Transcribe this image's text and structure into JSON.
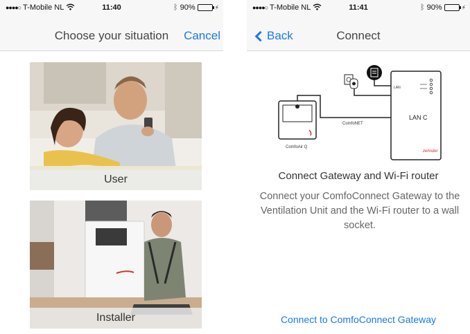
{
  "status_left": {
    "carrier": "T-Mobile NL",
    "time": "11:40",
    "battery": "90%",
    "battery_level": 0.9
  },
  "status_right": {
    "carrier": "T-Mobile NL",
    "time": "11:41",
    "battery": "90%",
    "battery_level": 0.9
  },
  "situation": {
    "title": "Choose your situation",
    "cancel_label": "Cancel",
    "options": [
      {
        "label": "User"
      },
      {
        "label": "Installer"
      }
    ]
  },
  "connect": {
    "back_label": "Back",
    "title": "Connect",
    "diagram": {
      "lan_label": "LAN",
      "unit_label": "LAN C",
      "bus_label": "ComfoNET",
      "device_label": "ComfoAir Q",
      "brand_label": "zehnder"
    },
    "heading": "Connect Gateway and Wi-Fi router",
    "body": "Connect your ComfoConnect Gateway to the Ventilation Unit and the Wi-Fi router to a wall socket.",
    "link_label": "Connect to ComfoConnect Gateway"
  },
  "colors": {
    "link": "#1a7ae8",
    "battery": "#3bd63b"
  }
}
